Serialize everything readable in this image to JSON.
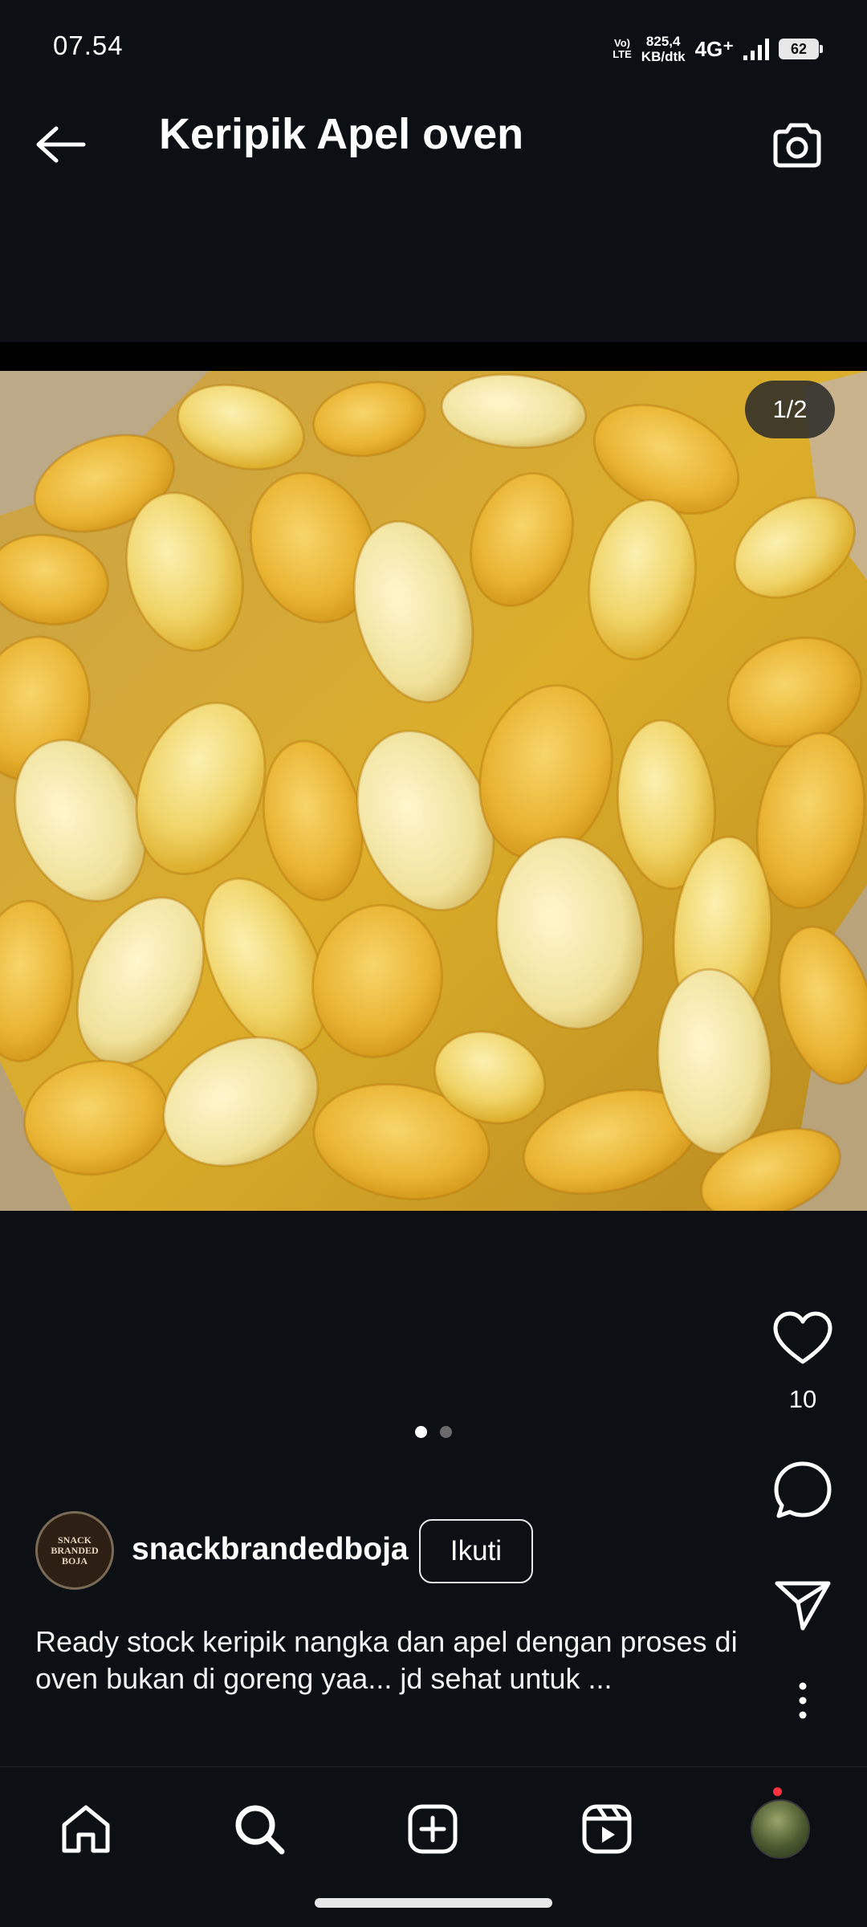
{
  "status_bar": {
    "time": "07.54",
    "volte_top": "Vo)",
    "volte_bottom": "LTE",
    "speed_value": "825,4",
    "speed_unit": "KB/dtk",
    "network": "4G⁺",
    "battery": "62"
  },
  "header": {
    "title": "Keripik Apel oven",
    "back_icon": "arrow-left-icon",
    "camera_icon": "camera-icon"
  },
  "post": {
    "image_counter": "1/2",
    "image_alt": "Keripik nangka",
    "carousel_total": 2,
    "carousel_active": 1,
    "like_count": "10",
    "author": {
      "username": "snackbrandedboja",
      "avatar_text_line1": "SNACK",
      "avatar_text_line2": "BRANDED",
      "avatar_text_line3": "BOJA"
    },
    "follow_label": "Ikuti",
    "caption": "Ready stock keripik nangka dan apel dengan proses di oven bukan di goreng yaa... jd sehat untuk ..."
  },
  "nav": {
    "items": [
      "home-icon",
      "search-icon",
      "create-icon",
      "reels-icon",
      "profile-avatar"
    ]
  },
  "colors": {
    "background": "#0c1014",
    "text": "#f5f5f5",
    "notification": "#ff3040"
  }
}
